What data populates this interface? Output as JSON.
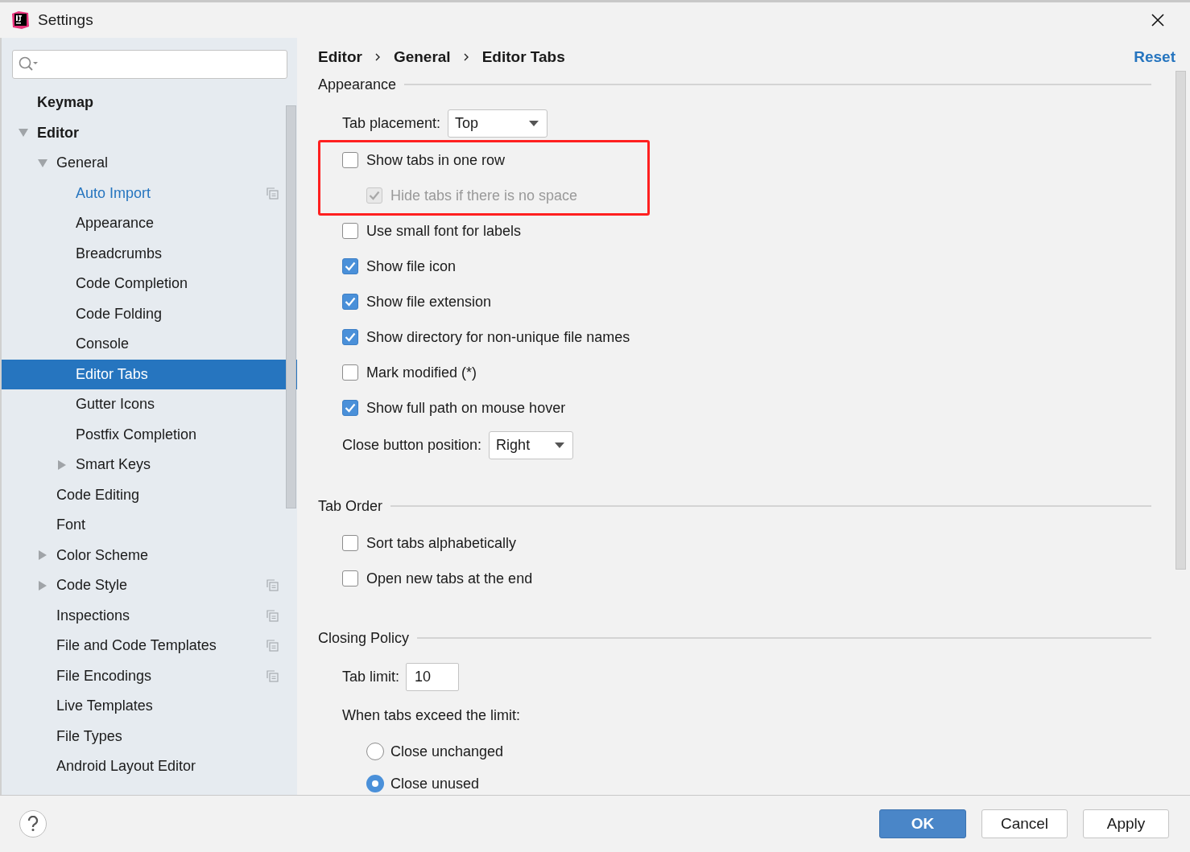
{
  "window": {
    "title": "Settings"
  },
  "sidebar": {
    "tree": [
      {
        "label": "Keymap",
        "selected": false
      },
      {
        "label": "Editor",
        "selected": false,
        "expanded": true,
        "children": [
          {
            "label": "General",
            "selected": false,
            "expanded": true,
            "children": [
              {
                "label": "Auto Import",
                "selected": false,
                "modified": true,
                "project_level": true
              },
              {
                "label": "Appearance",
                "selected": false
              },
              {
                "label": "Breadcrumbs",
                "selected": false
              },
              {
                "label": "Code Completion",
                "selected": false
              },
              {
                "label": "Code Folding",
                "selected": false
              },
              {
                "label": "Console",
                "selected": false
              },
              {
                "label": "Editor Tabs",
                "selected": true
              },
              {
                "label": "Gutter Icons",
                "selected": false
              },
              {
                "label": "Postfix Completion",
                "selected": false
              },
              {
                "label": "Smart Keys",
                "selected": false,
                "expanded": false
              }
            ]
          },
          {
            "label": "Code Editing",
            "selected": false
          },
          {
            "label": "Font",
            "selected": false
          },
          {
            "label": "Color Scheme",
            "selected": false,
            "expanded": false
          },
          {
            "label": "Code Style",
            "selected": false,
            "expanded": false,
            "project_level": true
          },
          {
            "label": "Inspections",
            "selected": false,
            "project_level": true
          },
          {
            "label": "File and Code Templates",
            "selected": false,
            "project_level": true
          },
          {
            "label": "File Encodings",
            "selected": false,
            "project_level": true
          },
          {
            "label": "Live Templates",
            "selected": false
          },
          {
            "label": "File Types",
            "selected": false
          },
          {
            "label": "Android Layout Editor",
            "selected": false
          }
        ]
      }
    ]
  },
  "breadcrumbs": [
    "Editor",
    "General",
    "Editor Tabs"
  ],
  "reset": "Reset",
  "sections": [
    {
      "title": "Appearance",
      "items": [
        {
          "kind": "dropdown",
          "label": "Tab placement:",
          "value": "Top"
        },
        {
          "kind": "highlight",
          "items": [
            {
              "kind": "checkbox",
              "label": "Show tabs in one row",
              "checked": false,
              "disabled": false,
              "children": [
                {
                  "kind": "checkbox",
                  "label": "Hide tabs if there is no space",
                  "checked": true,
                  "disabled": true
                }
              ]
            }
          ]
        },
        {
          "kind": "checkbox",
          "label": "Use small font for labels",
          "checked": false,
          "disabled": false
        },
        {
          "kind": "checkbox",
          "label": "Show file icon",
          "checked": true,
          "disabled": false
        },
        {
          "kind": "checkbox",
          "label": "Show file extension",
          "checked": true,
          "disabled": false
        },
        {
          "kind": "checkbox",
          "label": "Show directory for non-unique file names",
          "checked": true,
          "disabled": false
        },
        {
          "kind": "checkbox",
          "label": "Mark modified (*)",
          "checked": false,
          "disabled": false
        },
        {
          "kind": "checkbox",
          "label": "Show full path on mouse hover",
          "checked": true,
          "disabled": false
        },
        {
          "kind": "dropdown",
          "label": "Close button position:",
          "value": "Right"
        }
      ]
    },
    {
      "title": "Tab Order",
      "items": [
        {
          "kind": "checkbox",
          "label": "Sort tabs alphabetically",
          "checked": false,
          "disabled": false
        },
        {
          "kind": "checkbox",
          "label": "Open new tabs at the end",
          "checked": false,
          "disabled": false
        }
      ]
    },
    {
      "title": "Closing Policy",
      "items": [
        {
          "kind": "text_field",
          "label": "Tab limit:",
          "value": "10"
        },
        {
          "kind": "label",
          "label": "When tabs exceed the limit:"
        },
        {
          "kind": "radio",
          "label": "Close unchanged",
          "selected": false
        },
        {
          "kind": "radio",
          "label": "Close unused",
          "selected": true
        }
      ]
    }
  ],
  "buttons": [
    {
      "label": "OK",
      "primary": true
    },
    {
      "label": "Cancel",
      "primary": false
    },
    {
      "label": "Apply",
      "primary": false
    }
  ]
}
